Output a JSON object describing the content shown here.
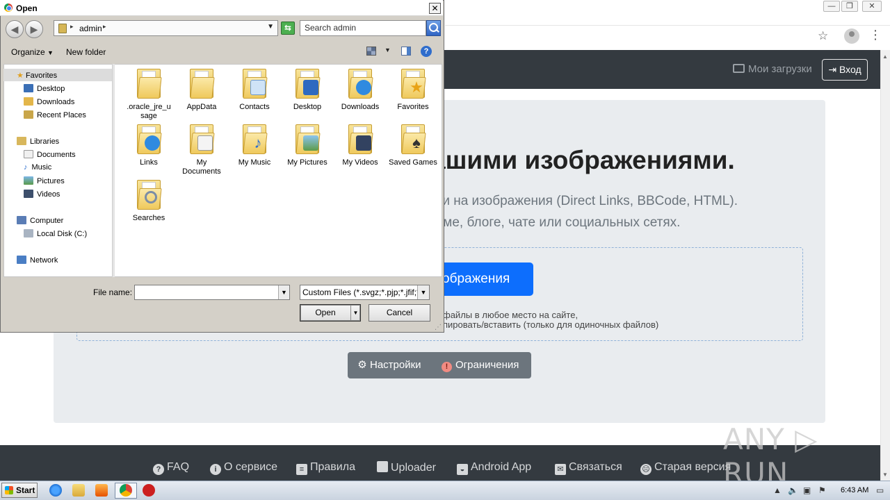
{
  "browser": {
    "window_controls": [
      "—",
      "❐",
      "✕"
    ],
    "star_icon": "star-icon",
    "profile_icon": "profile-icon",
    "menu_icon": "kebab-menu-icon"
  },
  "site": {
    "header": {
      "my_uploads": "Мои загрузки",
      "login": "Вход"
    },
    "hero": {
      "title": "ашими изображениями.",
      "subtitle_1": "ки на изображения (Direct Links, BBCode, HTML).",
      "subtitle_2": "уме, блоге, чате или социальных сетях.",
      "upload_button": "ображения",
      "drop_hint_1": "файлы в любое место на сайте,",
      "drop_hint_2": "пировать/вставить (только для одиночных файлов)",
      "settings_label": "Настройки",
      "limits_label": "Ограничения"
    },
    "footer": {
      "links": [
        "FAQ",
        "О сервисе",
        "Правила",
        "Uploader",
        "Android App",
        "Связаться",
        "Старая версия"
      ]
    },
    "watermark": "ANY ▷ RUN"
  },
  "dialog": {
    "title": "Open",
    "close": "✕",
    "address": {
      "crumb": "admin"
    },
    "search_placeholder": "Search admin",
    "toolbar": {
      "organize": "Organize",
      "new_folder": "New folder",
      "help": "?"
    },
    "nav": {
      "favorites": "Favorites",
      "desktop": "Desktop",
      "downloads": "Downloads",
      "recent_places": "Recent Places",
      "libraries": "Libraries",
      "documents": "Documents",
      "music": "Music",
      "pictures": "Pictures",
      "videos": "Videos",
      "computer": "Computer",
      "local_disk": "Local Disk (C:)",
      "network": "Network"
    },
    "files": [
      ".oracle_jre_u sage",
      "AppData",
      "Contacts",
      "Desktop",
      "Downloads",
      "Favorites",
      "Links",
      "My Documents",
      "My Music",
      "My Pictures",
      "My Videos",
      "Saved Games",
      "Searches"
    ],
    "file_name_label": "File name:",
    "file_name_value": "",
    "filter": "Custom Files (*.svgz;*.pjp;*.jfif;*",
    "open_button": "Open",
    "cancel_button": "Cancel"
  },
  "taskbar": {
    "start": "Start",
    "clock": "6:43 AM"
  }
}
